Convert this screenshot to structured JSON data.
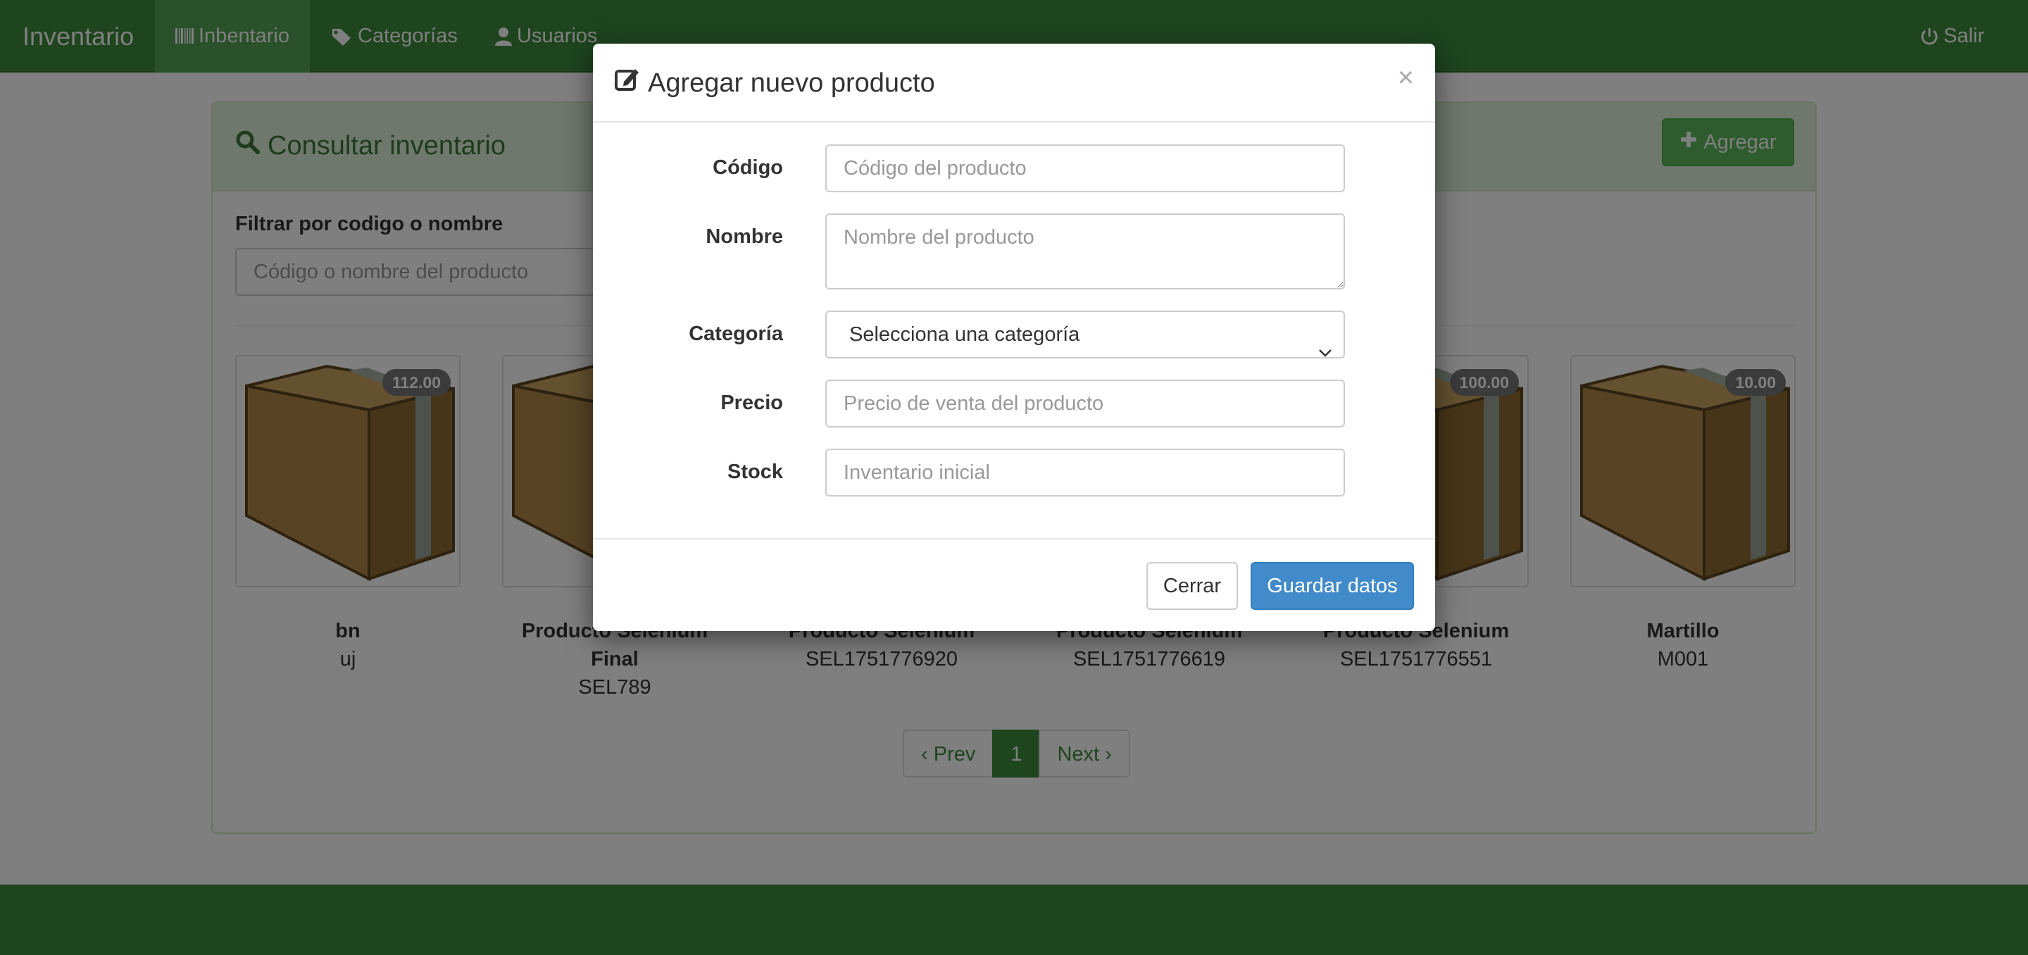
{
  "navbar": {
    "brand": "Inventario",
    "items": [
      {
        "label": "Inbentario",
        "icon": "barcode-icon",
        "active": true
      },
      {
        "label": "Categorías",
        "icon": "tags-icon",
        "active": false
      },
      {
        "label": "Usuarios",
        "icon": "user-icon",
        "active": false
      }
    ],
    "logout_label": "Salir",
    "logout_icon": "power-icon"
  },
  "panel": {
    "title": "Consultar inventario",
    "title_icon": "search-icon",
    "add_button": "Agregar",
    "filter_label": "Filtrar por codigo o nombre",
    "filter_placeholder": "Código o nombre del producto"
  },
  "products": [
    {
      "name": "bn",
      "code": "uj",
      "price": "112.00"
    },
    {
      "name": "Producto Selenium Final",
      "code": "SEL789",
      "price": ""
    },
    {
      "name": "Producto Selenium",
      "code": "SEL1751776920",
      "price": ""
    },
    {
      "name": "Producto Selenium",
      "code": "SEL1751776619",
      "price": ""
    },
    {
      "name": "Producto Selenium",
      "code": "SEL1751776551",
      "price": "100.00"
    },
    {
      "name": "Martillo",
      "code": "M001",
      "price": "10.00"
    }
  ],
  "pagination": {
    "prev": "‹ Prev",
    "current": "1",
    "next": "Next ›"
  },
  "modal": {
    "title": "Agregar nuevo producto",
    "title_icon": "edit-icon",
    "close_symbol": "×",
    "fields": {
      "codigo": {
        "label": "Código",
        "placeholder": "Código del producto"
      },
      "nombre": {
        "label": "Nombre",
        "placeholder": "Nombre del producto"
      },
      "categoria": {
        "label": "Categoría",
        "selected": "Selecciona una categoría"
      },
      "precio": {
        "label": "Precio",
        "placeholder": "Precio de venta del producto"
      },
      "stock": {
        "label": "Stock",
        "placeholder": "Inventario inicial"
      }
    },
    "close_button": "Cerrar",
    "save_button": "Guardar datos"
  },
  "colors": {
    "navbar": "#3d8b3d",
    "primary": "#428bca",
    "success": "#5cb85c"
  }
}
